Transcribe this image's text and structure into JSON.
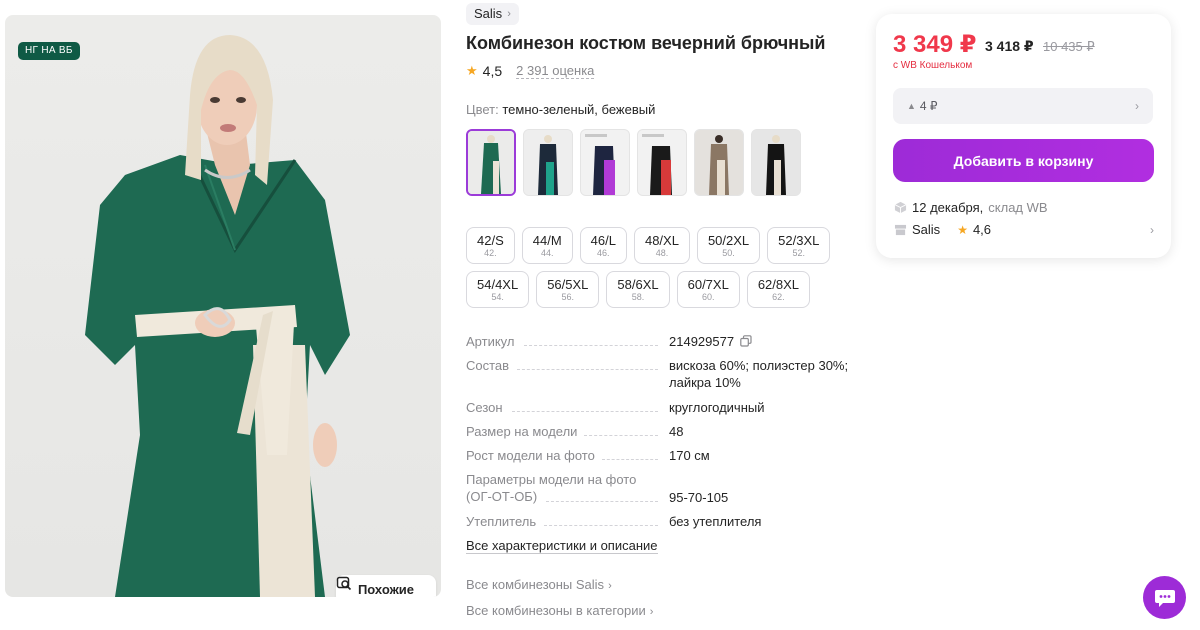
{
  "photo": {
    "badge": "НГ НА ВБ",
    "similar_label": "Похожие"
  },
  "product": {
    "brand": "Salis",
    "title": "Комбинезон костюм вечерний брючный",
    "rating": "4,5",
    "reviews": "2 391 оценка",
    "color_label": "Цвет:",
    "color_value": "темно-зеленый, бежевый"
  },
  "sizes": [
    {
      "main": "42/S",
      "sub": "42."
    },
    {
      "main": "44/M",
      "sub": "44."
    },
    {
      "main": "46/L",
      "sub": "46."
    },
    {
      "main": "48/XL",
      "sub": "48."
    },
    {
      "main": "50/2XL",
      "sub": "50."
    },
    {
      "main": "52/3XL",
      "sub": "52."
    },
    {
      "main": "54/4XL",
      "sub": "54."
    },
    {
      "main": "56/5XL",
      "sub": "56."
    },
    {
      "main": "58/6XL",
      "sub": "58."
    },
    {
      "main": "60/7XL",
      "sub": "60."
    },
    {
      "main": "62/8XL",
      "sub": "62."
    }
  ],
  "characteristics": [
    {
      "label": "Артикул",
      "value": "214929577"
    },
    {
      "label": "Состав",
      "value": "вискоза 60%; полиэстер 30%; лайкра 10%"
    },
    {
      "label": "Сезон",
      "value": "круглогодичный"
    },
    {
      "label": "Размер на модели",
      "value": "48"
    },
    {
      "label": "Рост модели на фото",
      "value": "170 см"
    },
    {
      "label": "Параметры модели на фото (ОГ-ОТ-ОБ)",
      "value": "95-70-105"
    },
    {
      "label": "Утеплитель",
      "value": "без утеплителя"
    }
  ],
  "links": {
    "all_chars": "Все характеристики и описание",
    "all_brand": "Все комбинезоны Salis",
    "all_category": "Все комбинезоны в категории"
  },
  "buy": {
    "price": "3 349 ₽",
    "price_regular": "3 418 ₽",
    "price_old": "10 435 ₽",
    "wallet_note": "с WB Кошельком",
    "delta": "4 ₽",
    "add_to_cart": "Добавить в корзину",
    "delivery_date": "12 декабря,",
    "delivery_place": "склад WB",
    "seller_name": "Salis",
    "seller_rating": "4,6"
  },
  "colors": {
    "accent": "#9d2bd7",
    "price": "#f0384b",
    "dress_green": "#1e6a52"
  }
}
